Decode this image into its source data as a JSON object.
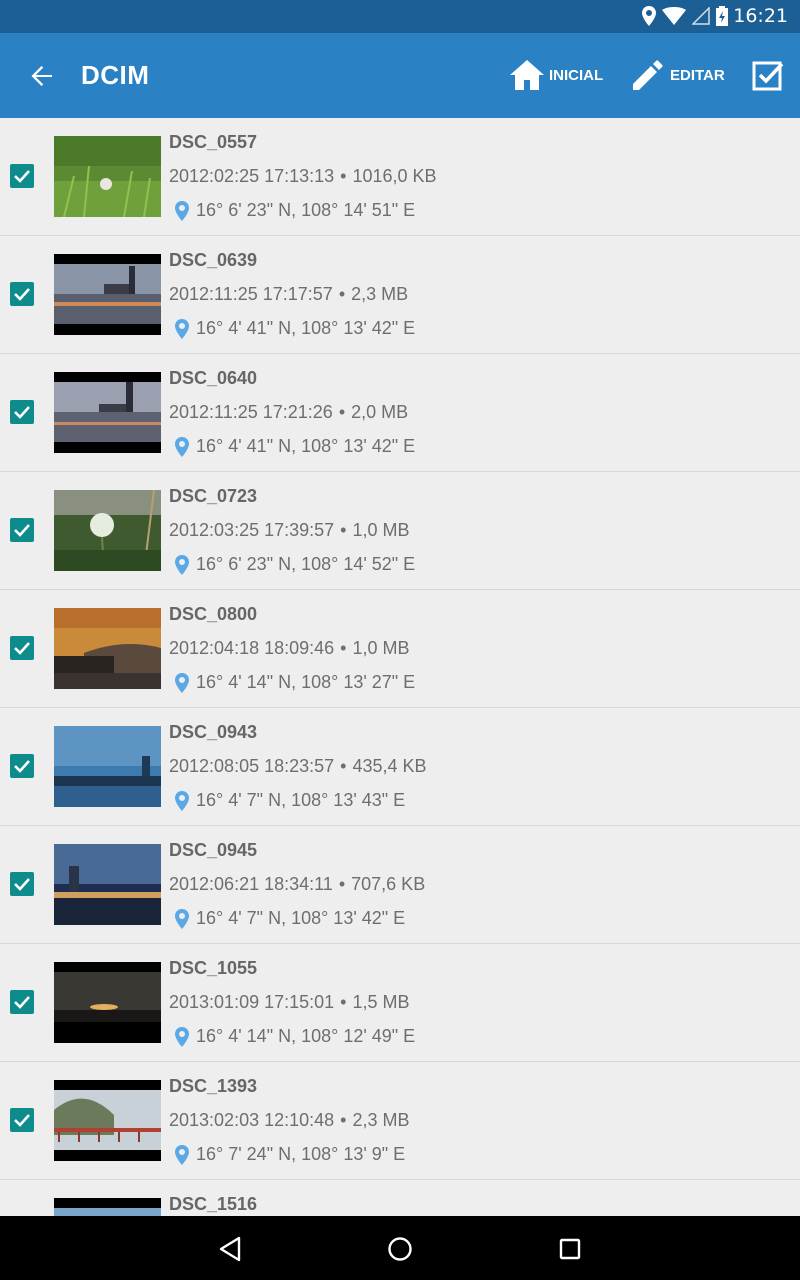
{
  "status": {
    "time": "16:21"
  },
  "header": {
    "back_icon": "arrow-left-icon",
    "title": "DCIM",
    "home_label": "INICIAL",
    "edit_label": "EDITAR",
    "select_all_icon": "checkbox-icon",
    "bar_color": "#2a82c5",
    "status_color": "#1b5f95",
    "checkbox_color": "#0e8c8c",
    "pin_color": "#5aa9e6"
  },
  "files": [
    {
      "name": "DSC_0557",
      "date": "2012:02:25 17:13:13",
      "size": "1016,0 KB",
      "location": "16° 6' 23\" N, 108° 14' 51\" E",
      "checked": true
    },
    {
      "name": "DSC_0639",
      "date": "2012:11:25 17:17:57",
      "size": "2,3 MB",
      "location": "16° 4' 41\" N, 108° 13' 42\" E",
      "checked": true
    },
    {
      "name": "DSC_0640",
      "date": "2012:11:25 17:21:26",
      "size": "2,0 MB",
      "location": "16° 4' 41\" N, 108° 13' 42\" E",
      "checked": true
    },
    {
      "name": "DSC_0723",
      "date": "2012:03:25 17:39:57",
      "size": "1,0 MB",
      "location": "16° 6' 23\" N, 108° 14' 52\" E",
      "checked": true
    },
    {
      "name": "DSC_0800",
      "date": "2012:04:18 18:09:46",
      "size": "1,0 MB",
      "location": "16° 4' 14\" N, 108° 13' 27\" E",
      "checked": true
    },
    {
      "name": "DSC_0943",
      "date": "2012:08:05 18:23:57",
      "size": "435,4 KB",
      "location": "16° 4' 7\" N, 108° 13' 43\" E",
      "checked": true
    },
    {
      "name": "DSC_0945",
      "date": "2012:06:21 18:34:11",
      "size": "707,6 KB",
      "location": "16° 4' 7\" N, 108° 13' 42\" E",
      "checked": true
    },
    {
      "name": "DSC_1055",
      "date": "2013:01:09 17:15:01",
      "size": "1,5 MB",
      "location": "16° 4' 14\" N, 108° 12' 49\" E",
      "checked": true
    },
    {
      "name": "DSC_1393",
      "date": "2013:02:03 12:10:48",
      "size": "2,3 MB",
      "location": "16° 7' 24\" N, 108° 13' 9\" E",
      "checked": true
    },
    {
      "name": "DSC_1516",
      "date": "",
      "size": "",
      "location": "",
      "checked": false
    }
  ],
  "navigation": {
    "back_icon": "nav-back-icon",
    "home_icon": "nav-home-icon",
    "recents_icon": "nav-recents-icon"
  }
}
